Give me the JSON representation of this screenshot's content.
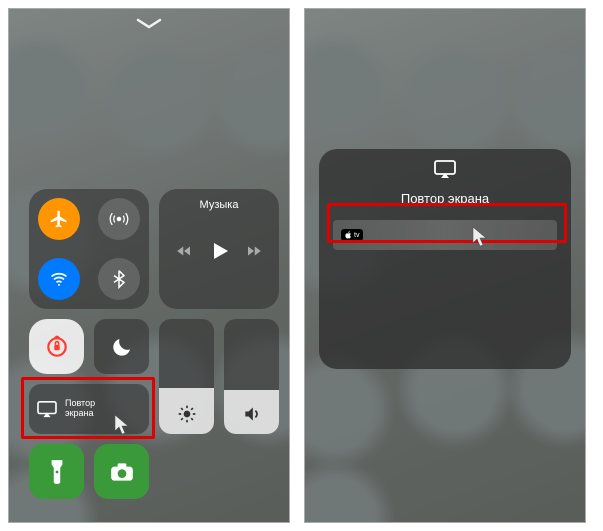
{
  "panel1": {
    "music_label": "Музыка",
    "screen_mirroring_label": "Повтор\nэкрана",
    "brightness_percent": 40,
    "volume_percent": 38
  },
  "panel2": {
    "sheet_title": "Повтор экрана",
    "device_badge": "tv",
    "device_name": ""
  }
}
